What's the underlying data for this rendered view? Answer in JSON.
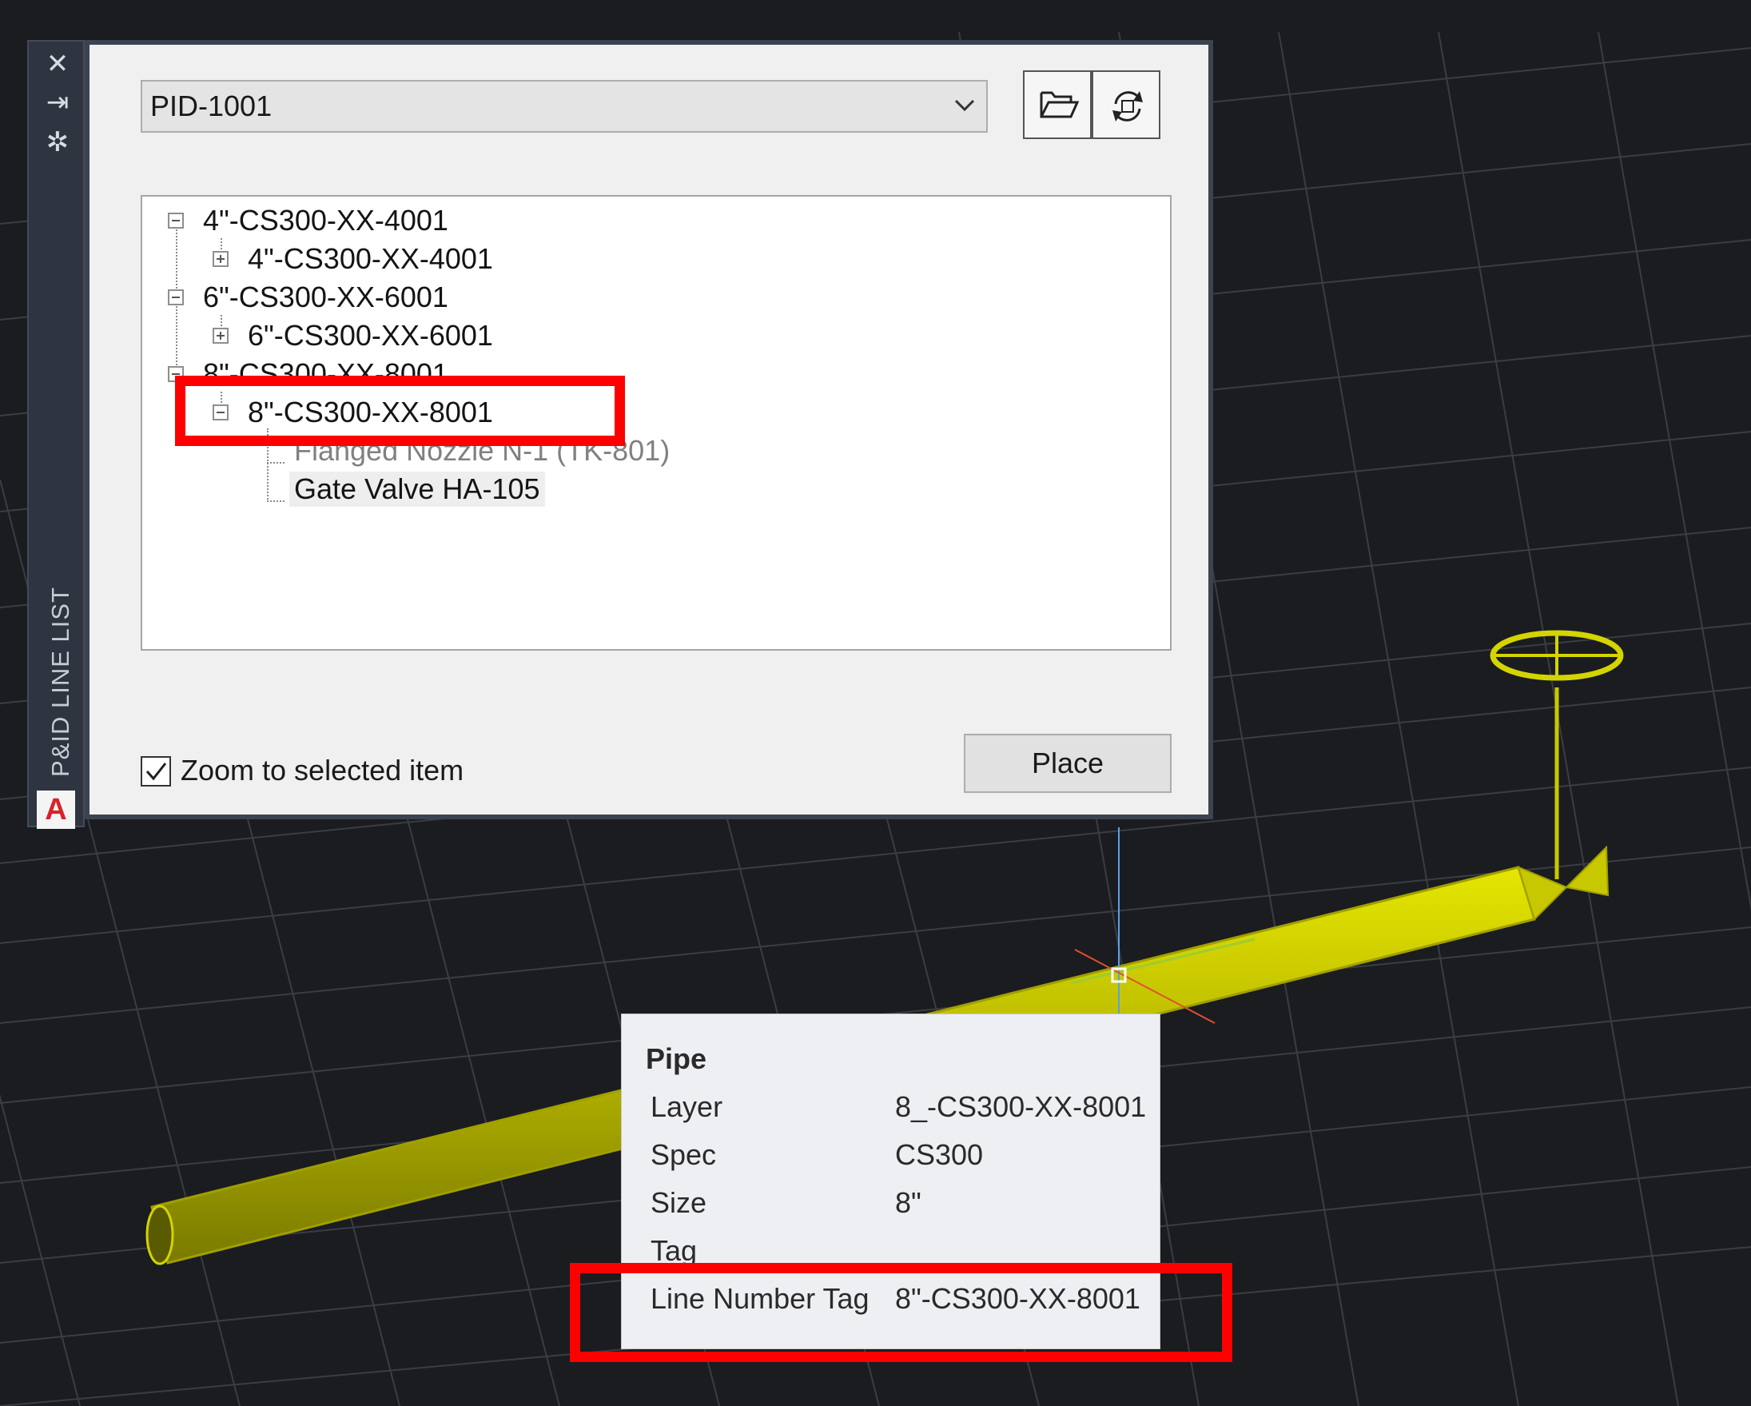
{
  "palette": {
    "title": "P&ID LINE LIST",
    "close_icon": "close-icon",
    "autohide_icon": "autohide-icon",
    "properties_icon": "properties-icon",
    "logo_letter": "A"
  },
  "drawing_select": {
    "value": "PID-1001"
  },
  "toolbar": {
    "open_icon": "folder-open-icon",
    "refresh_icon": "refresh-icon"
  },
  "tree": {
    "n1": "4\"-CS300-XX-4001",
    "n1c": "4\"-CS300-XX-4001",
    "n2": "6\"-CS300-XX-6001",
    "n2c": "6\"-CS300-XX-6001",
    "n3": "8\"-CS300-XX-8001",
    "n3c": "8\"-CS300-XX-8001",
    "n3c1": "Flanged Nozzle N-1 (TK-801)",
    "n3c2": "Gate Valve HA-105"
  },
  "zoom_option": {
    "label": "Zoom to selected item",
    "checked": true
  },
  "place_button": "Place",
  "tooltip": {
    "title": "Pipe",
    "rows": [
      {
        "label": "Layer",
        "value": "8_-CS300-XX-8001"
      },
      {
        "label": "Spec",
        "value": "CS300"
      },
      {
        "label": "Size",
        "value": "8\""
      },
      {
        "label": "Tag",
        "value": ""
      },
      {
        "label": "Line Number Tag",
        "value": "8\"-CS300-XX-8001"
      }
    ]
  },
  "colors": {
    "viewport_bg": "#1b1c20",
    "grid": "#3a3d44",
    "pipe": "#c8c800",
    "highlight": "#ff0000"
  }
}
